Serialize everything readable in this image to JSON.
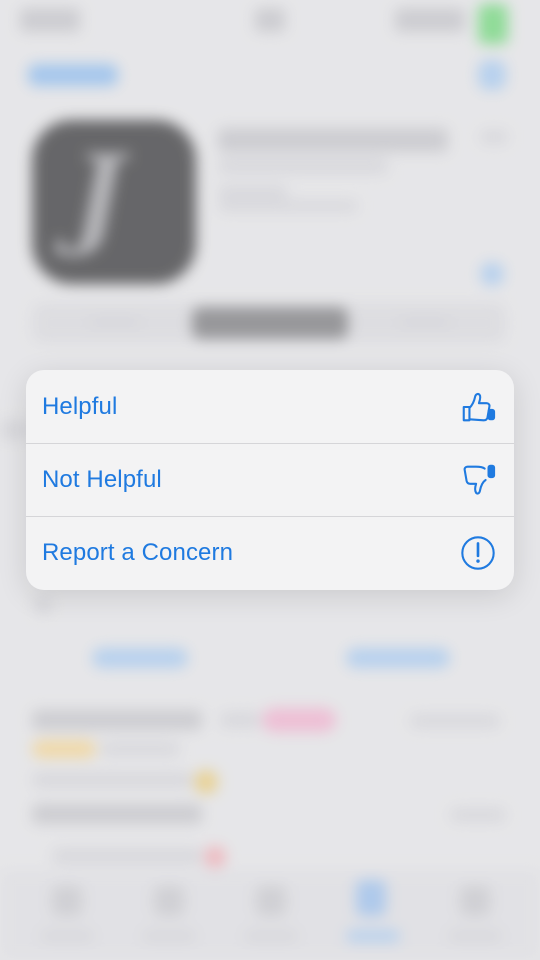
{
  "menu": {
    "items": [
      {
        "label": "Helpful",
        "icon": "thumbs-up-icon"
      },
      {
        "label": "Not Helpful",
        "icon": "thumbs-down-icon"
      },
      {
        "label": "Report a Concern",
        "icon": "exclamation-circle-icon"
      }
    ]
  },
  "background": {
    "app_icon_glyph": "J"
  },
  "colors": {
    "accent": "#1f7ae0",
    "menu_background": "#f3f3f4"
  }
}
